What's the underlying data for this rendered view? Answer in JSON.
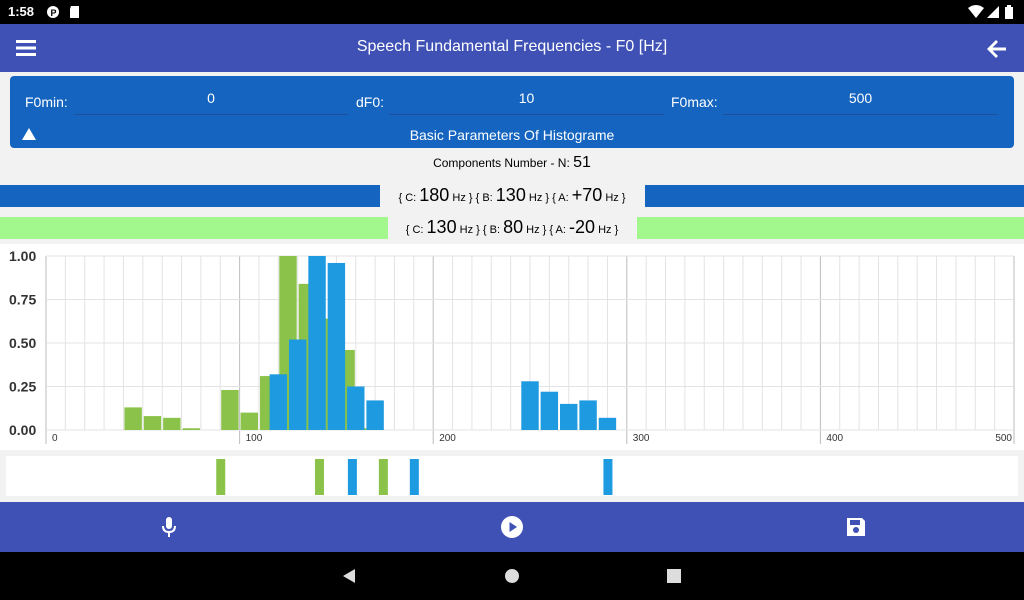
{
  "status_bar": {
    "time": "1:58",
    "icons": [
      "p-icon",
      "sd-card-icon",
      "wifi-icon",
      "signal-icon",
      "battery-icon"
    ]
  },
  "app_bar": {
    "title": "Speech Fundamental Frequencies - F0 [Hz]"
  },
  "params": {
    "f0min_label": "F0min:",
    "f0min_value": "0",
    "df0_label": "dF0:",
    "df0_value": "10",
    "f0max_label": "F0max:",
    "f0max_value": "500",
    "title": "Basic Parameters Of Histograme"
  },
  "components": {
    "label": "Components Number - N:",
    "value": "51"
  },
  "blue_info": {
    "c_pre": "{ C:",
    "c_val": "180",
    "c_post": "Hz } { B:",
    "b_val": "130",
    "b_post": "Hz } { A:",
    "a_val": "+70",
    "a_post": "Hz }"
  },
  "green_info": {
    "c_pre": "{ C:",
    "c_val": "130",
    "c_post": "Hz } { B:",
    "b_val": "80",
    "b_post": "Hz } { A:",
    "a_val": "-20",
    "a_post": "Hz }"
  },
  "colors": {
    "blue": "#1e9ae0",
    "green": "#8bc34a",
    "blue_bar": "#1565c0",
    "green_bar": "#a2f78d",
    "appbar": "#3f51b5"
  },
  "chart_data": {
    "type": "bar",
    "xlim": [
      0,
      500
    ],
    "ylim": [
      0,
      1
    ],
    "xticks": [
      "0",
      "100",
      "200",
      "300",
      "400",
      "500"
    ],
    "yticks": [
      "0.00",
      "0.25",
      "0.50",
      "0.75",
      "1.00"
    ],
    "grid": true,
    "series": [
      {
        "color": "#8bc34a",
        "points": [
          [
            45,
            0.13
          ],
          [
            55,
            0.08
          ],
          [
            65,
            0.07
          ],
          [
            75,
            0.01
          ],
          [
            95,
            0.23
          ],
          [
            105,
            0.1
          ],
          [
            115,
            0.31
          ],
          [
            125,
            1.0
          ],
          [
            135,
            0.84
          ],
          [
            145,
            0.64
          ],
          [
            155,
            0.46
          ],
          [
            165,
            0.01
          ]
        ]
      },
      {
        "color": "#1e9ae0",
        "points": [
          [
            120,
            0.32
          ],
          [
            130,
            0.52
          ],
          [
            140,
            1.0
          ],
          [
            150,
            0.96
          ],
          [
            160,
            0.25
          ],
          [
            170,
            0.17
          ],
          [
            250,
            0.28
          ],
          [
            260,
            0.22
          ],
          [
            270,
            0.15
          ],
          [
            280,
            0.17
          ],
          [
            290,
            0.07
          ]
        ]
      }
    ]
  },
  "strip_data": {
    "xlim": [
      0,
      500
    ],
    "marks": [
      {
        "x": 90,
        "color": "#8bc34a"
      },
      {
        "x": 141,
        "color": "#8bc34a"
      },
      {
        "x": 158,
        "color": "#1e9ae0"
      },
      {
        "x": 174,
        "color": "#8bc34a"
      },
      {
        "x": 190,
        "color": "#1e9ae0"
      },
      {
        "x": 290,
        "color": "#1e9ae0"
      }
    ]
  },
  "bottom_bar": {
    "icons": [
      "microphone-icon",
      "play-icon",
      "save-icon"
    ]
  },
  "nav_bar": {
    "icons": [
      "back-triangle-icon",
      "home-circle-icon",
      "recents-square-icon"
    ]
  }
}
